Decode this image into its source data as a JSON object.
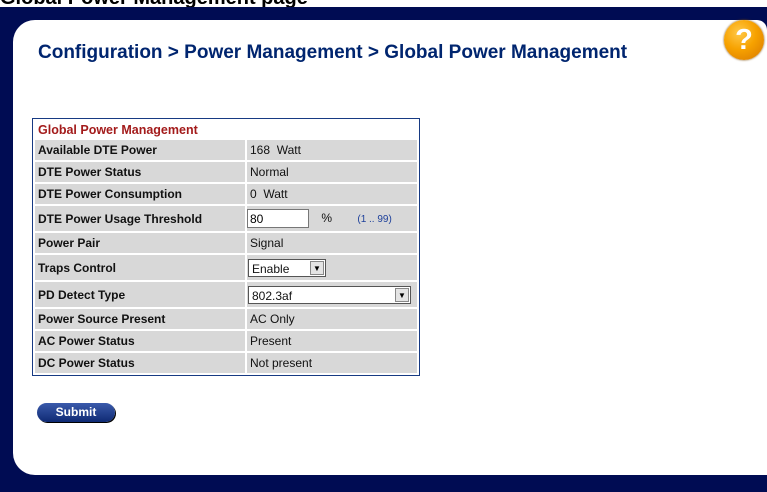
{
  "doc_caption": "Global Power Management page",
  "help_glyph": "?",
  "breadcrumb": "Configuration > Power Management > Global Power Management",
  "form": {
    "title": "Global Power Management",
    "available_power": {
      "label": "Available DTE Power",
      "value": "168  Watt"
    },
    "power_status": {
      "label": "DTE Power Status",
      "value": "Normal"
    },
    "power_consumption": {
      "label": "DTE Power Consumption",
      "value": "0  Watt"
    },
    "usage_threshold": {
      "label": "DTE Power Usage Threshold",
      "value": "80",
      "unit": "%",
      "range": "(1 .. 99)"
    },
    "power_pair": {
      "label": "Power Pair",
      "value": "Signal"
    },
    "traps_control": {
      "label": "Traps Control",
      "selected": "Enable"
    },
    "pd_detect_type": {
      "label": "PD Detect Type",
      "selected": "802.3af"
    },
    "power_source": {
      "label": "Power Source Present",
      "value": "AC Only"
    },
    "ac_power_status": {
      "label": "AC Power Status",
      "value": "Present"
    },
    "dc_power_status": {
      "label": "DC Power Status",
      "value": "Not present"
    }
  },
  "submit_label": "Submit",
  "colors": {
    "frame": "#000c53",
    "breadcrumb": "#00256f",
    "title": "#a31b1b",
    "row_bg": "#d8d8d8"
  },
  "icons": {
    "help": "help-icon",
    "dropdown": "chevron-down-icon"
  }
}
